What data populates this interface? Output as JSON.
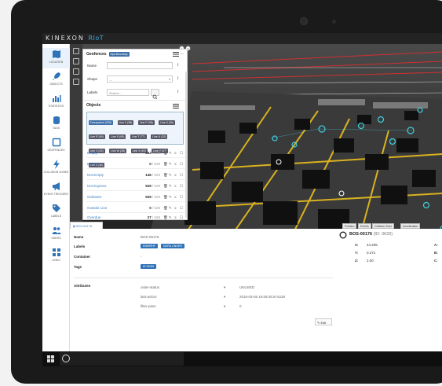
{
  "app": {
    "brand": "KINEXON",
    "brand_sub": "RIoT"
  },
  "nav": {
    "items": [
      {
        "label": "Location",
        "icon": "map-icon"
      },
      {
        "label": "Objects",
        "icon": "rocket-icon"
      },
      {
        "label": "Statistics",
        "icon": "bar-chart-icon"
      },
      {
        "label": "Tags",
        "icon": "database-icon"
      },
      {
        "label": "Geofences",
        "icon": "square-icon"
      },
      {
        "label": "Collision Zones",
        "icon": "bolt-icon"
      },
      {
        "label": "Event Triggers",
        "icon": "megaphone-icon"
      },
      {
        "label": "Labels",
        "icon": "tags-icon"
      },
      {
        "label": "Users",
        "icon": "users-icon"
      },
      {
        "label": "Links",
        "icon": "grid-icon"
      }
    ]
  },
  "filters": {
    "geofences_title": "Geofences",
    "geofences_chip": "Spd.Boundary",
    "name_label": "Name",
    "shape_label": "Shape",
    "shape_value": "---",
    "labels_label": "Labels",
    "labels_placeholder": "Search...",
    "objects_title": "Objects",
    "chips": [
      "Everywhere (326)",
      "Line 0 (38)",
      "Line P (36)",
      "Line 0 (39)",
      "Line R (94)",
      "Line S (60)",
      "Line T (77)",
      "Line U (32)",
      "Line V (43)",
      "Line W (35)",
      "Line X (49)",
      "Line Y (47)",
      "Line Z (40)"
    ],
    "rows": [
      {
        "name": "Empty",
        "count": "363",
        "total": "/ 529"
      },
      {
        "name": "Express",
        "count": "0",
        "total": "/ 529"
      },
      {
        "name": "Not Empty",
        "count": "146",
        "total": "/ 529"
      },
      {
        "name": "Not Express",
        "count": "529",
        "total": "/ 529"
      },
      {
        "name": "Ordinaire",
        "count": "529",
        "total": "/ 529"
      },
      {
        "name": "Outside Line",
        "count": "0",
        "total": "/ 529"
      },
      {
        "name": "Overdue",
        "count": "27",
        "total": "/ 529"
      }
    ]
  },
  "scene_tabs": [
    "Position",
    "Events",
    "Collision Zone",
    "Acceleration"
  ],
  "detail": {
    "tab_label": "BOS-00176",
    "name_label": "Name",
    "name_value": "BOS-00176",
    "labels_label": "Labels",
    "labels_tags": [
      "EMWRHF",
      "NORA LINGER"
    ],
    "container_label": "Container",
    "container_value": "-",
    "tags_label": "Tags",
    "tags_tag": "ID 39939",
    "attributes_label": "Attributes",
    "attributes": [
      {
        "key": "order-status",
        "value": "UNUSED"
      },
      {
        "key": "last-action",
        "value": "2018-03-05 16:09:28.674228"
      },
      {
        "key": "filter-pass",
        "value": "0"
      }
    ],
    "edit_label": "Edit",
    "tag_id": "BOS-00176",
    "tag_sub": "(ID: 3629)",
    "coords": [
      {
        "axis": "X:",
        "value": "44.205"
      },
      {
        "axis": "Y:",
        "value": "0.271"
      },
      {
        "axis": "Z:",
        "value": "2.00"
      }
    ],
    "rot": [
      {
        "axis": "A:",
        "value": ""
      },
      {
        "axis": "B:",
        "value": ""
      },
      {
        "axis": "C:",
        "value": ""
      }
    ]
  },
  "colors": {
    "accent": "#2f73b8",
    "link": "#3d7fc4",
    "nav_bg": "#ffffff",
    "scene_bg": "#2b2b2b"
  }
}
